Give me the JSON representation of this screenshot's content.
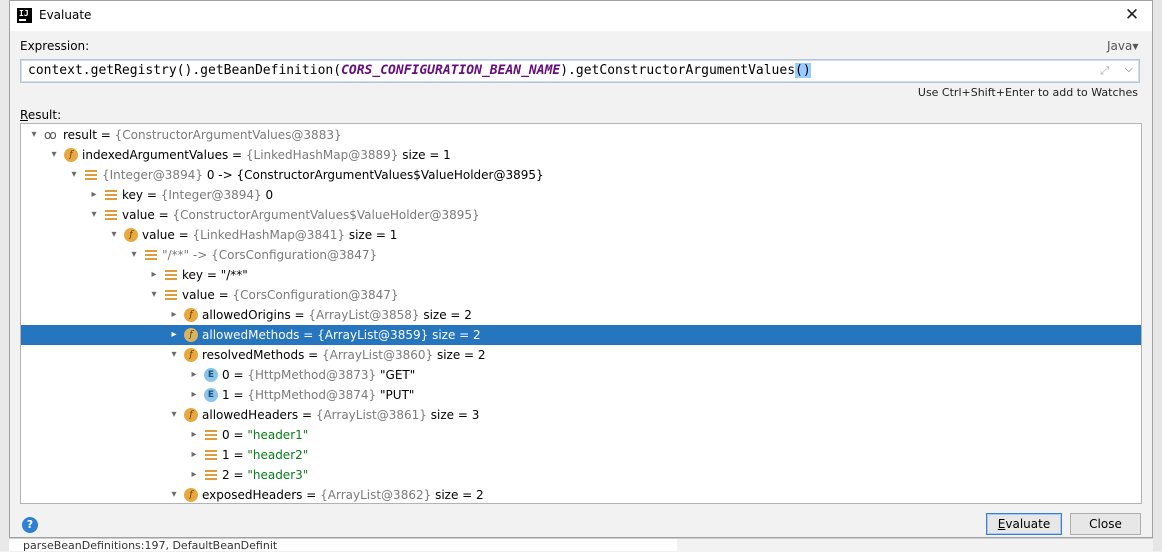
{
  "background": {
    "bottom_text": "parseBeanDefinitions:197, DefaultBeanDefinit"
  },
  "window": {
    "title": "Evaluate",
    "close_glyph": "✕"
  },
  "expression": {
    "label": "Expression:",
    "language": "Java",
    "code_prefix": "context.getRegistry().getBeanDefinition(",
    "code_constant": "CORS_CONFIGURATION_BEAN_NAME",
    "code_mid": ").getConstructorArgumentValues",
    "code_highlight": "()",
    "hint": "Use Ctrl+Shift+Enter to add to Watches"
  },
  "result": {
    "label_underlined": "R",
    "label_rest": "esult:",
    "rows": [
      {
        "depth": 0,
        "arrow": "▾",
        "icon": "glasses",
        "name": "result",
        "ref": "{ConstructorArgumentValues@3883}",
        "extra": "",
        "string_value": false
      },
      {
        "depth": 1,
        "arrow": "▾",
        "icon": "f",
        "name": "indexedArgumentValues",
        "ref": "{LinkedHashMap@3889}",
        "extra": "size = 1",
        "string_value": false
      },
      {
        "depth": 2,
        "arrow": "▾",
        "icon": "lines",
        "name": "",
        "ref": "{Integer@3894}",
        "extra": "0 -> {ConstructorArgumentValues$ValueHolder@3895}",
        "string_value": false
      },
      {
        "depth": 3,
        "arrow": "▸",
        "icon": "lines",
        "name": "key",
        "ref": "{Integer@3894}",
        "extra": "0",
        "string_value": false
      },
      {
        "depth": 3,
        "arrow": "▾",
        "icon": "lines",
        "name": "value",
        "ref": "{ConstructorArgumentValues$ValueHolder@3895}",
        "extra": "",
        "string_value": false
      },
      {
        "depth": 4,
        "arrow": "▾",
        "icon": "f",
        "name": "value",
        "ref": "{LinkedHashMap@3841}",
        "extra": "size = 1",
        "string_value": false
      },
      {
        "depth": 5,
        "arrow": "▾",
        "icon": "lines",
        "name": "",
        "ref": "\"/**\" -> {CorsConfiguration@3847}",
        "extra": "",
        "string_value": false
      },
      {
        "depth": 6,
        "arrow": "▸",
        "icon": "lines",
        "name": "key",
        "ref": "",
        "extra": "\"/**\"",
        "string_value": false
      },
      {
        "depth": 6,
        "arrow": "▾",
        "icon": "lines",
        "name": "value",
        "ref": "{CorsConfiguration@3847}",
        "extra": "",
        "string_value": false
      },
      {
        "depth": 7,
        "arrow": "▸",
        "icon": "f",
        "name": "allowedOrigins",
        "ref": "{ArrayList@3858}",
        "extra": "size = 2",
        "string_value": false
      },
      {
        "depth": 7,
        "arrow": "▸",
        "icon": "f",
        "name": "allowedMethods",
        "ref": "{ArrayList@3859}",
        "extra": "size = 2",
        "string_value": false,
        "selected": true
      },
      {
        "depth": 7,
        "arrow": "▾",
        "icon": "f",
        "name": "resolvedMethods",
        "ref": "{ArrayList@3860}",
        "extra": "size = 2",
        "string_value": false
      },
      {
        "depth": 8,
        "arrow": "▸",
        "icon": "e",
        "name": "0",
        "ref": "{HttpMethod@3873}",
        "extra": "\"GET\"",
        "string_value": false
      },
      {
        "depth": 8,
        "arrow": "▸",
        "icon": "e",
        "name": "1",
        "ref": "{HttpMethod@3874}",
        "extra": "\"PUT\"",
        "string_value": false
      },
      {
        "depth": 7,
        "arrow": "▾",
        "icon": "f",
        "name": "allowedHeaders",
        "ref": "{ArrayList@3861}",
        "extra": "size = 3",
        "string_value": false
      },
      {
        "depth": 8,
        "arrow": "▸",
        "icon": "lines",
        "name": "0",
        "ref": "",
        "extra": "\"header1\"",
        "string_value": true
      },
      {
        "depth": 8,
        "arrow": "▸",
        "icon": "lines",
        "name": "1",
        "ref": "",
        "extra": "\"header2\"",
        "string_value": true
      },
      {
        "depth": 8,
        "arrow": "▸",
        "icon": "lines",
        "name": "2",
        "ref": "",
        "extra": "\"header3\"",
        "string_value": true
      },
      {
        "depth": 7,
        "arrow": "▾",
        "icon": "f",
        "name": "exposedHeaders",
        "ref": "{ArrayList@3862}",
        "extra": "size = 2",
        "string_value": false
      }
    ]
  },
  "footer": {
    "help_glyph": "?",
    "evaluate_underlined": "E",
    "evaluate_rest": "valuate",
    "close_label": "Close"
  },
  "colors": {
    "selection": "#2675bf",
    "field_icon": "#e8a83f",
    "enum_icon": "#89c4ea",
    "string": "#067d17",
    "constant": "#660e7a"
  }
}
